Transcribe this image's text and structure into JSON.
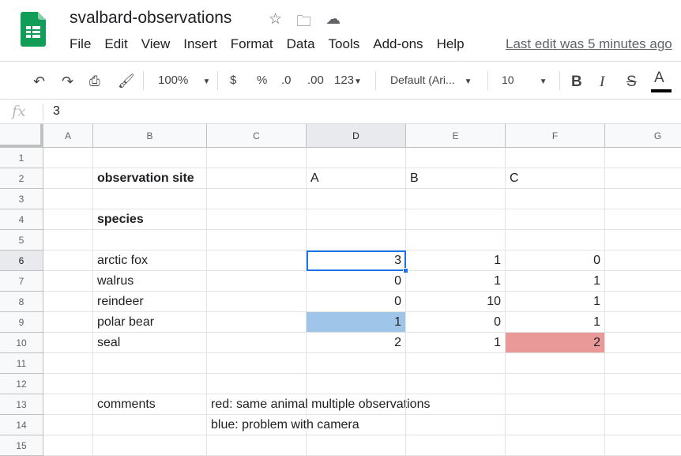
{
  "app": {
    "title": "svalbard-observations",
    "last_edit": "Last edit was 5 minutes ago",
    "menu": [
      "File",
      "Edit",
      "View",
      "Insert",
      "Format",
      "Data",
      "Tools",
      "Add-ons",
      "Help"
    ]
  },
  "toolbar": {
    "zoom": "100%",
    "currency": "$",
    "percent": "%",
    "dec_decrease": ".0",
    "dec_increase": ".00",
    "format": "123",
    "font": "Default (Ari...",
    "font_size": "10",
    "bold": "B",
    "italic": "I",
    "strike": "S",
    "text_color": "A"
  },
  "formula_bar": {
    "fx": "fx",
    "value": "3"
  },
  "columns": [
    "A",
    "B",
    "C",
    "D",
    "E",
    "F",
    "G"
  ],
  "selected_cell": "D6",
  "colors": {
    "blue_fill": "#9fc5e8",
    "red_fill": "#ea9999",
    "selection": "#1a73e8"
  },
  "rows": [
    {
      "n": "1",
      "cells": {}
    },
    {
      "n": "2",
      "cells": {
        "B": "observation site",
        "D": "A",
        "E": "B",
        "F": "C"
      }
    },
    {
      "n": "3",
      "cells": {}
    },
    {
      "n": "4",
      "cells": {
        "B": "species"
      }
    },
    {
      "n": "5",
      "cells": {}
    },
    {
      "n": "6",
      "cells": {
        "B": "arctic fox",
        "D": "3",
        "E": "1",
        "F": "0"
      }
    },
    {
      "n": "7",
      "cells": {
        "B": "walrus",
        "D": "0",
        "E": "1",
        "F": "1"
      }
    },
    {
      "n": "8",
      "cells": {
        "B": "reindeer",
        "D": "0",
        "E": "10",
        "F": "1"
      }
    },
    {
      "n": "9",
      "cells": {
        "B": "polar bear",
        "D": "1",
        "E": "0",
        "F": "1"
      }
    },
    {
      "n": "10",
      "cells": {
        "B": "seal",
        "D": "2",
        "E": "1",
        "F": "2"
      }
    },
    {
      "n": "11",
      "cells": {}
    },
    {
      "n": "12",
      "cells": {}
    },
    {
      "n": "13",
      "cells": {
        "B": "comments",
        "C": "red: same animal multiple observations"
      }
    },
    {
      "n": "14",
      "cells": {
        "C": "blue: problem with camera"
      }
    },
    {
      "n": "15",
      "cells": {}
    }
  ]
}
